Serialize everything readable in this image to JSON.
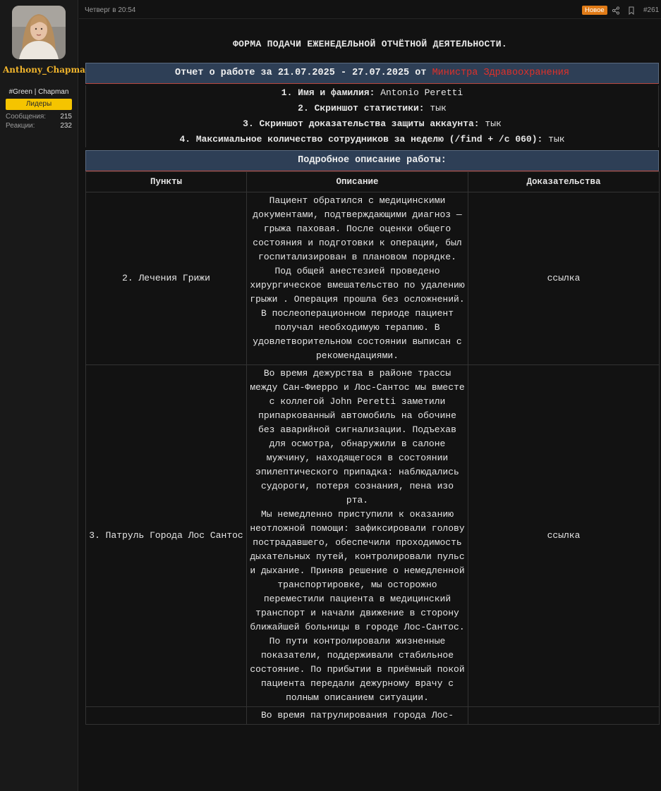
{
  "user": {
    "name": "Anthony_Chapman",
    "title": "#Green | Chapman",
    "badge": "Лидеры",
    "stats": [
      {
        "label": "Сообщения:",
        "value": "215"
      },
      {
        "label": "Реакции:",
        "value": "232"
      }
    ]
  },
  "post": {
    "date": "Четверг в 20:54",
    "new_badge": "Новое",
    "number": "#261"
  },
  "form": {
    "title": "ФОРМА ПОДАЧИ ЕЖЕНЕДЕЛЬНОЙ ОТЧЁТНОЙ ДЕЯТЕЛЬНОСТИ.",
    "report_header_prefix": "Отчет о работе за 21.07.2025 - 27.07.2025 от ",
    "report_header_role": "Министра Здравоохранения",
    "items": [
      {
        "label": "1. Имя и фамилия: ",
        "value": "Antonio Peretti"
      },
      {
        "label": "2. Скриншот статистики: ",
        "value": "тык"
      },
      {
        "label": "3. Скриншот доказательства защиты аккаунта: ",
        "value": "тык"
      },
      {
        "label": "4. Максимальное количество сотрудников за неделю (/find + /c 060): ",
        "value": "тык"
      }
    ],
    "details_header": "Подробное описание работы:",
    "columns": [
      "Пункты",
      "Описание",
      "Доказательства"
    ],
    "rows": [
      {
        "point": "2. Лечения Грижи",
        "description": "Пациент обратился с медицинскими документами, подтверждающими диагноз — грыжа паховая. После оценки общего состояния и подготовки к операции, был госпитализирован в плановом порядке. Под общей анестезией проведено хирургическое вмешательство по удалению грыжи . Операция прошла без осложнений. В послеоперационном периоде пациент получал необходимую терапию. В удовлетворительном состоянии выписан с рекомендациями.",
        "proof": "ссылка"
      },
      {
        "point": "3. Патруль Города Лос Сантос",
        "description": "Во время дежурства в районе трассы между Сан-Фиерро и Лос-Сантос мы вместе с коллегой John Peretti заметили припаркованный автомобиль на обочине без аварийной сигнализации. Подъехав для осмотра, обнаружили в салоне мужчину, находящегося в состоянии эпилептического припадка: наблюдались судороги, потеря сознания, пена изо рта.\nМы немедленно приступили к оказанию неотложной помощи: зафиксировали голову пострадавшего, обеспечили проходимость дыхательных путей, контролировали пульс и дыхание. Приняв решение о немедленной транспортировке, мы осторожно переместили пациента в медицинский транспорт и начали движение в сторону ближайшей больницы в городе Лос-Сантос.\nПо пути контролировали жизненные показатели, поддерживали стабильное состояние. По прибытии в приёмный покой пациента передали дежурному врачу с полным описанием ситуации.",
        "proof": "ссылка"
      },
      {
        "point": "",
        "description": "Во время патрулирования города Лос-",
        "proof": ""
      }
    ]
  },
  "colors": {
    "header_bg": "#2e3f56",
    "accent_red": "#e0302a",
    "username": "#f0b42c",
    "new_badge": "#e07b17",
    "leaders_badge": "#f5c400"
  }
}
